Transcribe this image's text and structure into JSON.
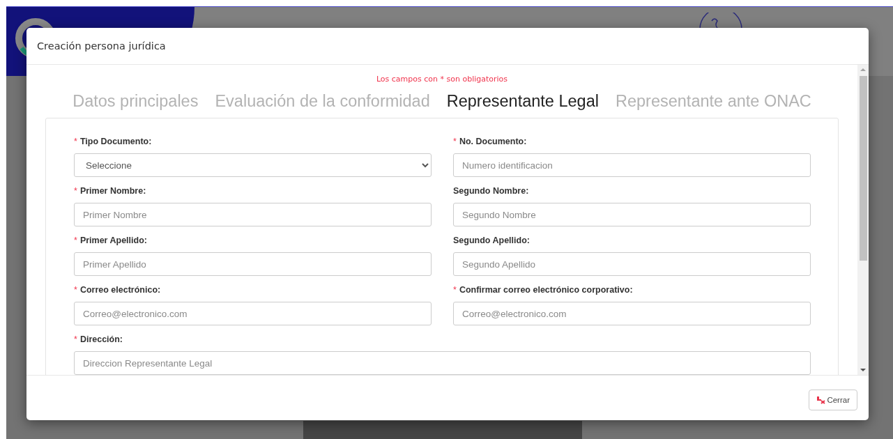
{
  "modal": {
    "title": "Creación persona jurídica",
    "required_note": "Los campos con * son obligatorios",
    "tabs": [
      {
        "label": "Datos principales",
        "selected": false
      },
      {
        "label": "Evaluación de la conformidad",
        "selected": false
      },
      {
        "label": "Representante Legal",
        "selected": true
      },
      {
        "label": "Representante ante ONAC",
        "selected": false
      }
    ],
    "fields": [
      {
        "kind": "select",
        "label": "Tipo Documento:",
        "required_mark": "*",
        "value": "Seleccione"
      },
      {
        "kind": "text",
        "label": "No. Documento:",
        "required_mark": "*",
        "placeholder": "Numero identificacion"
      },
      {
        "kind": "text",
        "label": "Primer Nombre:",
        "required_mark": "*",
        "placeholder": "Primer Nombre"
      },
      {
        "kind": "text",
        "label": "Segundo Nombre:",
        "placeholder": "Segundo Nombre"
      },
      {
        "kind": "text",
        "label": "Primer Apellido:",
        "required_mark": "*",
        "placeholder": "Primer Apellido"
      },
      {
        "kind": "text",
        "label": "Segundo Apellido:",
        "placeholder": "Segundo Apellido"
      },
      {
        "kind": "text",
        "label": "Correo electrónico:",
        "required_mark": "*",
        "placeholder": "Correo@electronico.com"
      },
      {
        "kind": "text",
        "label": "Confirmar correo electrónico corporativo:",
        "required_mark": "*",
        "placeholder": "Correo@electronico.com"
      },
      {
        "kind": "wide_text",
        "label": "Dirección:",
        "required_mark": "*",
        "placeholder": "Direccion Representante Legal"
      }
    ],
    "close_button": "Cerrar"
  }
}
